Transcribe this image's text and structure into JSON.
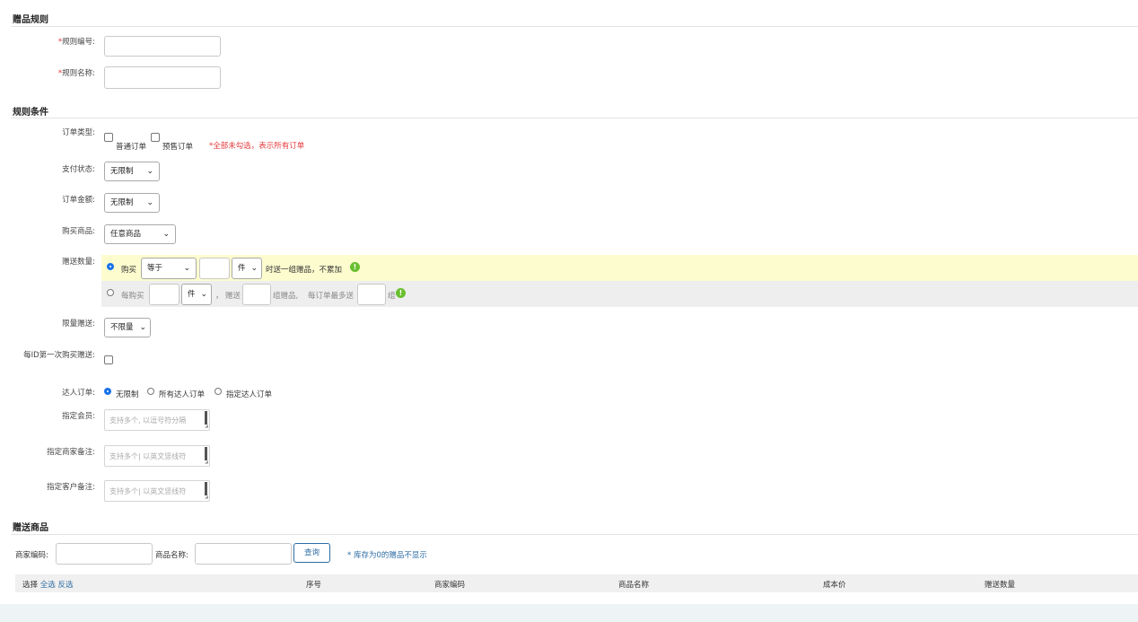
{
  "sections": {
    "gift_rule": "赠品规则",
    "rule_conditions": "规则条件",
    "gift_products": "赠送商品"
  },
  "fields": {
    "rule_code": "规则编号:",
    "rule_name": "规则名称:",
    "required_mark": "*",
    "order_type": "订单类型:",
    "order_type_normal": "普通订单",
    "order_type_presale": "预售订单",
    "order_type_hint": "*全部未勾选，表示所有订单",
    "pay_status": "支付状态:",
    "pay_status_value": "无限制",
    "order_amount": "订单金额:",
    "order_amount_value": "无限制",
    "buy_goods": "购买商品:",
    "buy_goods_value": "任意商品",
    "gift_qty": "赠送数量:",
    "limit_gift": "限量赠送:",
    "limit_gift_value": "不限量",
    "first_buy": "每ID第一次购买赠送:",
    "kol_order": "达人订单:",
    "kol_none": "无限制",
    "kol_all": "所有达人订单",
    "kol_specified": "指定达人订单",
    "member": "指定会员:",
    "member_placeholder": "支持多个, 以逗号符分隔",
    "merchant_note": "指定商家备注:",
    "merchant_note_placeholder": "支持多个| 以英文竖线符",
    "customer_note": "指定客户备注:",
    "customer_note_placeholder": "支持多个| 以英文竖线符"
  },
  "gift_qty_row1": {
    "buy": "购买",
    "compare": "等于",
    "unit": "件",
    "suffix": "时送一组赠品，不累加"
  },
  "gift_qty_row2": {
    "per_buy": "每购买",
    "unit": "件",
    "comma": "，",
    "give": "赠送",
    "groups_gift": "组赠品,",
    "max_per_order": "每订单最多送",
    "group": "组"
  },
  "search": {
    "merchant_code": "商家编码:",
    "product_name": "商品名称:",
    "query_button": "查询",
    "hint": "* 库存为0的赠品不显示"
  },
  "table": {
    "select": "选择",
    "select_all": "全选",
    "invert": "反选",
    "seq": "序号",
    "merchant_code": "商家编码",
    "product_name": "商品名称",
    "cost": "成本价",
    "gift_qty": "赠送数量"
  },
  "colors": {
    "accent": "#1a73e8",
    "highlight_row": "#fcfccf",
    "gray_row": "#eeeeee",
    "required": "#e4393c",
    "info_icon": "#6abf2f"
  }
}
